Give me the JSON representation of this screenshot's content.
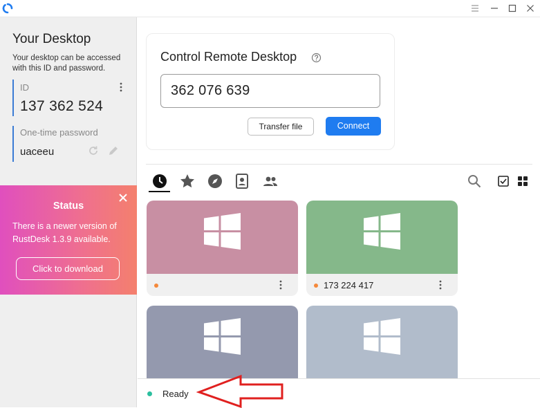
{
  "left_panel": {
    "title": "Your Desktop",
    "description": "Your desktop can be accessed with this ID and password.",
    "id_label": "ID",
    "id_value": "137 362 524",
    "password_label": "One-time password",
    "password_value": "uaceeu"
  },
  "status_card": {
    "title": "Status",
    "message": "There is a newer version of RustDesk 1.3.9 available.",
    "button_label": "Click to download"
  },
  "control": {
    "title": "Control Remote Desktop",
    "id_input_value": "362 076 639",
    "transfer_label": "Transfer file",
    "connect_label": "Connect"
  },
  "tabs": [
    "recent-sessions",
    "favorites",
    "discovered",
    "address-book",
    "group"
  ],
  "peers": [
    {
      "label": "",
      "color": "#c88fa3"
    },
    {
      "label": "173 224 417",
      "color": "#85b88a"
    },
    {
      "label": "",
      "color": "#9499ae"
    },
    {
      "label": "",
      "color": "#b1bccb"
    }
  ],
  "status_bar": {
    "label": "Ready"
  },
  "colors": {
    "accent": "#1f7cf0",
    "ready": "#2bbf9f",
    "online_dot": "#f5883a",
    "annotation_arrow": "#e0201f"
  }
}
